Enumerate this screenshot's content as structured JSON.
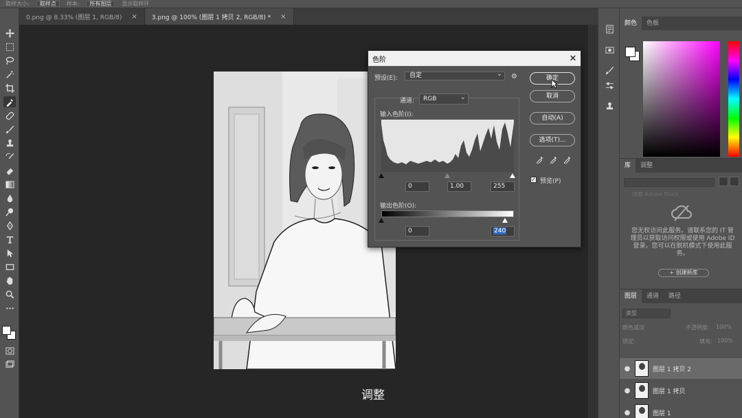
{
  "options_bar": {
    "sample_size_label": "取样大小:",
    "sample_size_value": "取样点",
    "sample_label": "样本:",
    "sample_value": "所有图层",
    "show_ring_label": "显示取样环"
  },
  "tabs": [
    {
      "label": "0.png @ 8.33% (图层 1, RGB/8)",
      "close": "×"
    },
    {
      "label": "3.png @ 100% (图层 1 拷贝 2, RGB/8) *",
      "close": "×"
    }
  ],
  "canvas": {
    "caption": "调整"
  },
  "color_panel": {
    "tabs": [
      "颜色",
      "色板"
    ]
  },
  "library_panel": {
    "tabs": [
      "库",
      "调整"
    ],
    "search_placeholder": "搜索 Adobe Stock",
    "message": "您无权访问此服务。请联系您的 IT 管理员以获取访问权限或使用 Adobe ID 登录。您可以在脱机模式下使用此服务。",
    "create_button": "+ 创建新库"
  },
  "layers_panel": {
    "tabs": [
      "图层",
      "通道",
      "路径"
    ],
    "filter_label": "类型",
    "blend_mode": "颜色减淡",
    "opacity_label": "不透明度:",
    "opacity_value": "100%",
    "lock_label": "锁定:",
    "fill_label": "填充:",
    "fill_value": "100%",
    "layers": [
      {
        "name": "图层 1 拷贝 2",
        "selected": true
      },
      {
        "name": "图层 1 拷贝",
        "selected": false
      },
      {
        "name": "图层 1",
        "selected": false
      }
    ]
  },
  "levels_dialog": {
    "title": "色阶",
    "close": "✕",
    "preset_label": "预设(E):",
    "preset_value": "自定",
    "channel_label": "通道:",
    "channel_value": "RGB",
    "input_label": "输入色阶(I):",
    "input_black": "0",
    "input_gamma": "1.00",
    "input_white": "255",
    "output_label": "输出色阶(O):",
    "output_black": "0",
    "output_white": "240",
    "buttons": {
      "ok": "确定",
      "cancel": "取消",
      "auto": "自动(A)",
      "options": "选项(T)..."
    },
    "preview_label": "预览(P)",
    "preview_checked": true
  }
}
